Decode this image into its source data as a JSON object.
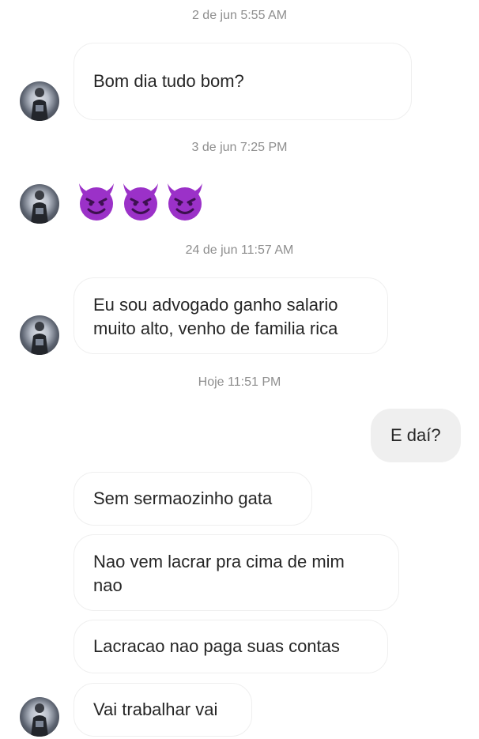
{
  "conversation": {
    "timestamps": [
      "2 de jun 5:55 AM",
      "3 de jun 7:25 PM",
      "24 de jun 11:57 AM",
      "Hoje 11:51 PM"
    ],
    "messages": {
      "m1": "Bom dia tudo bom?",
      "m2_emoji_icon": "smiling-devil-icon",
      "m2_emoji_count": 3,
      "m3_line1": "Eu sou advogado ganho salario",
      "m3_line2": "muito alto, venho de familia rica",
      "sent1": "E daí?",
      "m4": "Sem sermaozinho gata",
      "m5_line1": "Nao vem lacrar pra cima de mim",
      "m5_line2": "nao",
      "m6": "Lacracao nao paga suas contas",
      "m7": "Vai trabalhar vai"
    },
    "colors": {
      "devil_purple": "#9b31c8",
      "received_bubble": "#ffffff",
      "sent_bubble": "#efefef",
      "timestamp_text": "#8e8e8e"
    }
  }
}
